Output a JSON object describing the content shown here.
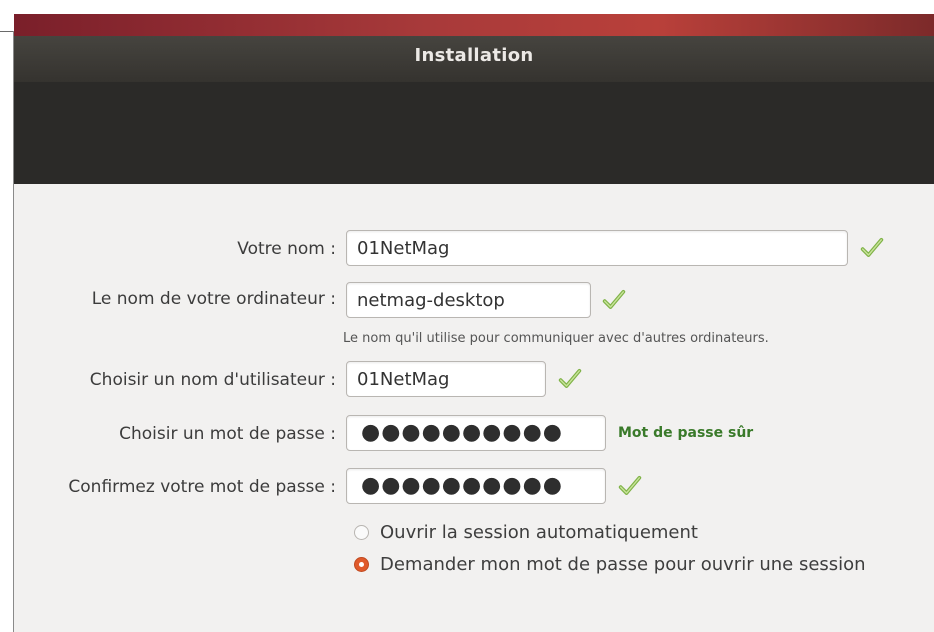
{
  "window": {
    "title": "Installation"
  },
  "form": {
    "name": {
      "label": "Votre nom :",
      "value": "01NetMag"
    },
    "computer": {
      "label": "Le nom de votre ordinateur :",
      "value": "netmag-desktop",
      "hint": "Le nom qu'il utilise pour communiquer avec d'autres ordinateurs."
    },
    "username": {
      "label": "Choisir un nom d'utilisateur :",
      "value": "01NetMag"
    },
    "password": {
      "label": "Choisir un mot de passe :",
      "value": "●●●●●●●●●●",
      "strength": "Mot de passe sûr"
    },
    "confirm": {
      "label": "Confirmez votre mot de passe :",
      "value": "●●●●●●●●●●"
    }
  },
  "login_options": [
    {
      "label": "Ouvrir la session automatiquement",
      "selected": false
    },
    {
      "label": "Demander mon mot de passe pour ouvrir une session",
      "selected": true
    }
  ],
  "colors": {
    "accent": "#e05a2b",
    "check": "#8cc04a",
    "strength": "#3a7a2a"
  }
}
